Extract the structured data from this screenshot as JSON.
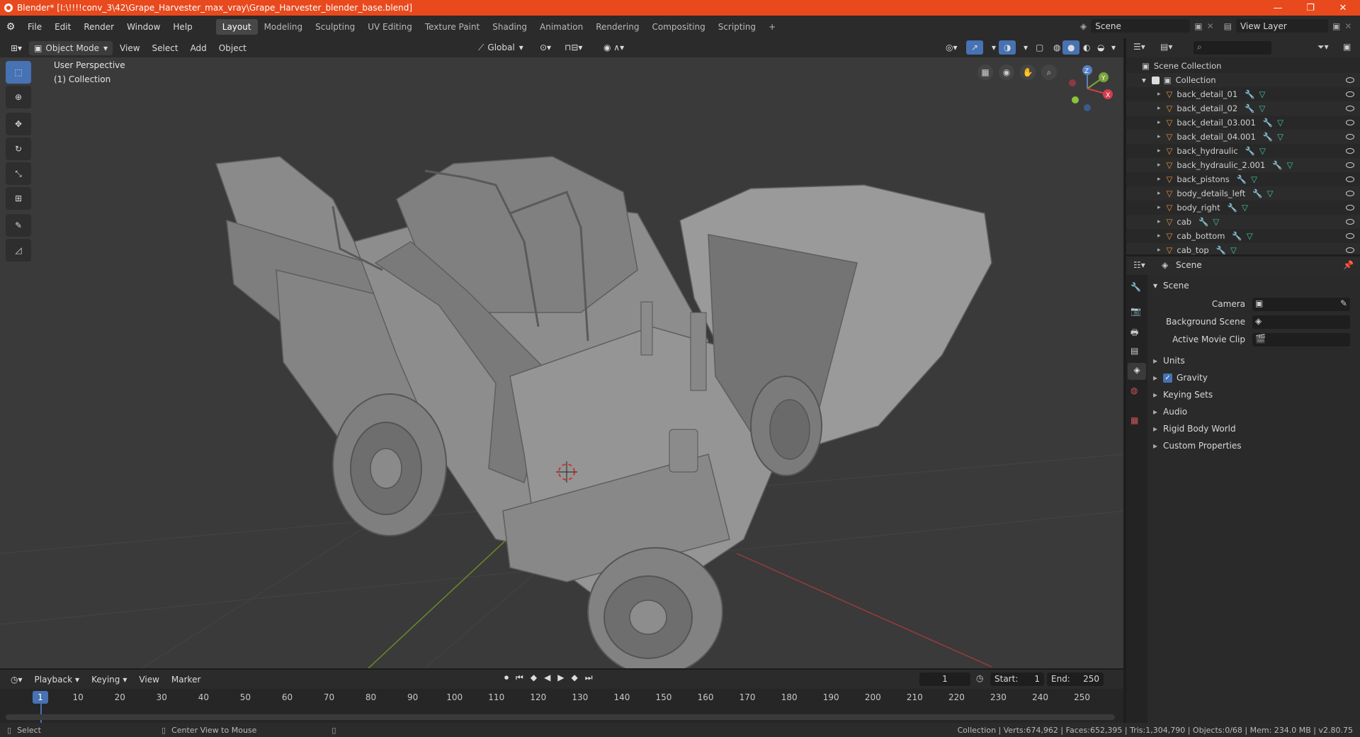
{
  "titlebar": {
    "title": "Blender* [I:\\!!!!conv_3\\42\\Grape_Harvester_max_vray\\Grape_Harvester_blender_base.blend]",
    "minimize": "—",
    "maximize": "❐",
    "close": "✕"
  },
  "menus": [
    "File",
    "Edit",
    "Render",
    "Window",
    "Help"
  ],
  "workspaces": [
    "Layout",
    "Modeling",
    "Sculpting",
    "UV Editing",
    "Texture Paint",
    "Shading",
    "Animation",
    "Rendering",
    "Compositing",
    "Scripting"
  ],
  "workspace_add": "+",
  "scene_selector": {
    "label": "Scene"
  },
  "view_layer": {
    "label": "View Layer"
  },
  "viewport_header": {
    "mode": "Object Mode",
    "view": "View",
    "select": "Select",
    "add": "Add",
    "object": "Object",
    "transform": "Global"
  },
  "viewport": {
    "perspective": "User Perspective",
    "collection": "(1) Collection"
  },
  "gizmo": {
    "x": "X",
    "y": "Y",
    "z": "Z"
  },
  "outliner": {
    "scene_collection": "Scene Collection",
    "collection": "Collection",
    "items": [
      "back_detail_01",
      "back_detail_02",
      "back_detail_03.001",
      "back_detail_04.001",
      "back_hydraulic",
      "back_hydraulic_2.001",
      "back_pistons",
      "body_details_left",
      "body_right",
      "cab",
      "cab_bottom",
      "cab_top"
    ]
  },
  "properties": {
    "header": "Scene",
    "panel_title": "Scene",
    "camera_label": "Camera",
    "background_scene_label": "Background Scene",
    "active_clip_label": "Active Movie Clip",
    "sections": [
      "Units",
      "Gravity",
      "Keying Sets",
      "Audio",
      "Rigid Body World",
      "Custom Properties"
    ],
    "gravity_checked": true
  },
  "timeline": {
    "playback": "Playback",
    "keying": "Keying",
    "view": "View",
    "marker": "Marker",
    "current_frame": "1",
    "start_label": "Start:",
    "start": "1",
    "end_label": "End:",
    "end": "250",
    "ticks": [
      "10",
      "20",
      "30",
      "40",
      "50",
      "60",
      "70",
      "80",
      "90",
      "100",
      "110",
      "120",
      "130",
      "140",
      "150",
      "160",
      "170",
      "180",
      "190",
      "200",
      "210",
      "220",
      "230",
      "240",
      "250"
    ]
  },
  "statusbar": {
    "select": "Select",
    "center": "Center View to Mouse",
    "stats": "Collection | Verts:674,962 | Faces:652,395 | Tris:1,304,790 | Objects:0/68 | Mem: 234.0 MB | v2.80.75"
  },
  "colors": {
    "title_accent": "#e8491d",
    "active_tool": "#4772b3",
    "object_orange": "#e8943a",
    "mesh_green": "#3ec9a0",
    "modifier_blue": "#6fa3e0"
  }
}
